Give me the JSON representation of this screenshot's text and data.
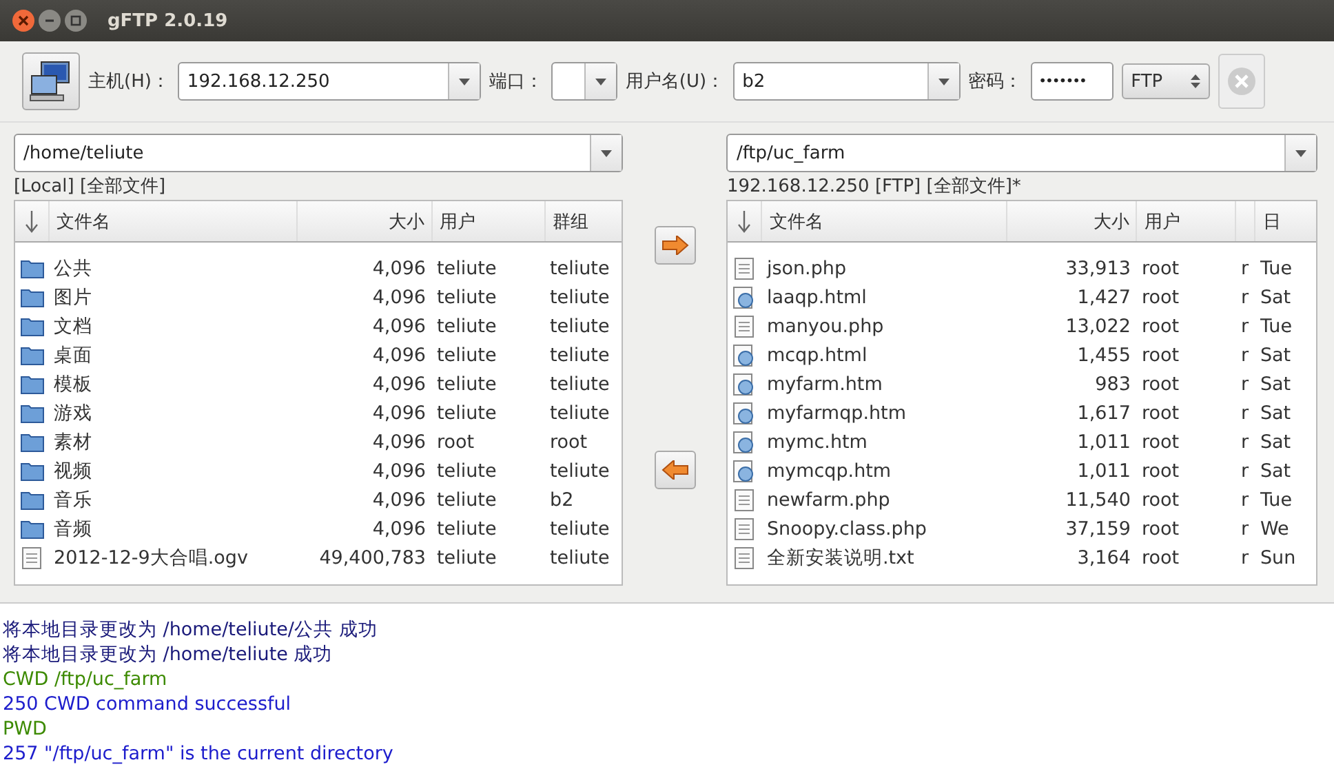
{
  "window": {
    "title": "gFTP 2.0.19"
  },
  "toolbar": {
    "host_label": "主机(H)：",
    "host": "192.168.12.250",
    "port_label": "端口：",
    "user_label": "用户名(U)：",
    "user": "b2",
    "password_label": "密码：",
    "password": "•••••••",
    "protocol": "FTP"
  },
  "local": {
    "path": "/home/teliute",
    "status": "[Local] [全部文件]",
    "columns": [
      "文件名",
      "大小",
      "用户",
      "群组"
    ],
    "rows": [
      {
        "kind": "folder",
        "cells": [
          "公共",
          "4,096",
          "teliute",
          "teliute"
        ]
      },
      {
        "kind": "folder",
        "cells": [
          "图片",
          "4,096",
          "teliute",
          "teliute"
        ]
      },
      {
        "kind": "folder",
        "cells": [
          "文档",
          "4,096",
          "teliute",
          "teliute"
        ]
      },
      {
        "kind": "folder",
        "cells": [
          "桌面",
          "4,096",
          "teliute",
          "teliute"
        ]
      },
      {
        "kind": "folder",
        "cells": [
          "模板",
          "4,096",
          "teliute",
          "teliute"
        ]
      },
      {
        "kind": "folder",
        "cells": [
          "游戏",
          "4,096",
          "teliute",
          "teliute"
        ]
      },
      {
        "kind": "folder",
        "cells": [
          "素材",
          "4,096",
          "root",
          "root"
        ]
      },
      {
        "kind": "folder",
        "cells": [
          "视频",
          "4,096",
          "teliute",
          "teliute"
        ]
      },
      {
        "kind": "folder",
        "cells": [
          "音乐",
          "4,096",
          "teliute",
          "b2"
        ]
      },
      {
        "kind": "folder",
        "cells": [
          "音频",
          "4,096",
          "teliute",
          "teliute"
        ]
      },
      {
        "kind": "file",
        "cells": [
          "2012-12-9大合唱.ogv",
          "49,400,783",
          "teliute",
          "teliute"
        ]
      }
    ]
  },
  "remote": {
    "path": "/ftp/uc_farm",
    "status": "192.168.12.250 [FTP] [全部文件]*",
    "columns": [
      "文件名",
      "大小",
      "用户",
      "",
      "日"
    ],
    "rows": [
      {
        "kind": "file",
        "cells": [
          "json.php",
          "33,913",
          "root",
          "r",
          "Tue"
        ]
      },
      {
        "kind": "web",
        "cells": [
          "laaqp.html",
          "1,427",
          "root",
          "r",
          "Sat"
        ]
      },
      {
        "kind": "file",
        "cells": [
          "manyou.php",
          "13,022",
          "root",
          "r",
          "Tue"
        ]
      },
      {
        "kind": "web",
        "cells": [
          "mcqp.html",
          "1,455",
          "root",
          "r",
          "Sat"
        ]
      },
      {
        "kind": "web",
        "cells": [
          "myfarm.htm",
          "983",
          "root",
          "r",
          "Sat"
        ]
      },
      {
        "kind": "web",
        "cells": [
          "myfarmqp.htm",
          "1,617",
          "root",
          "r",
          "Sat"
        ]
      },
      {
        "kind": "web",
        "cells": [
          "mymc.htm",
          "1,011",
          "root",
          "r",
          "Sat"
        ]
      },
      {
        "kind": "web",
        "cells": [
          "mymcqp.htm",
          "1,011",
          "root",
          "r",
          "Sat"
        ]
      },
      {
        "kind": "file",
        "cells": [
          "newfarm.php",
          "11,540",
          "root",
          "r",
          "Tue"
        ]
      },
      {
        "kind": "file",
        "cells": [
          "Snoopy.class.php",
          "37,159",
          "root",
          "r",
          "We"
        ]
      },
      {
        "kind": "file",
        "cells": [
          "全新安装说明.txt",
          "3,164",
          "root",
          "r",
          "Sun"
        ]
      }
    ]
  },
  "log": [
    {
      "kind": "local",
      "text": "将本地目录更改为 /home/teliute/公共 成功"
    },
    {
      "kind": "local",
      "text": "将本地目录更改为 /home/teliute 成功"
    },
    {
      "kind": "command",
      "text": "CWD /ftp/uc_farm"
    },
    {
      "kind": "response",
      "text": "250 CWD command successful"
    },
    {
      "kind": "command",
      "text": "PWD"
    },
    {
      "kind": "response",
      "text": "257 \"/ftp/uc_farm\" is the current directory"
    }
  ]
}
